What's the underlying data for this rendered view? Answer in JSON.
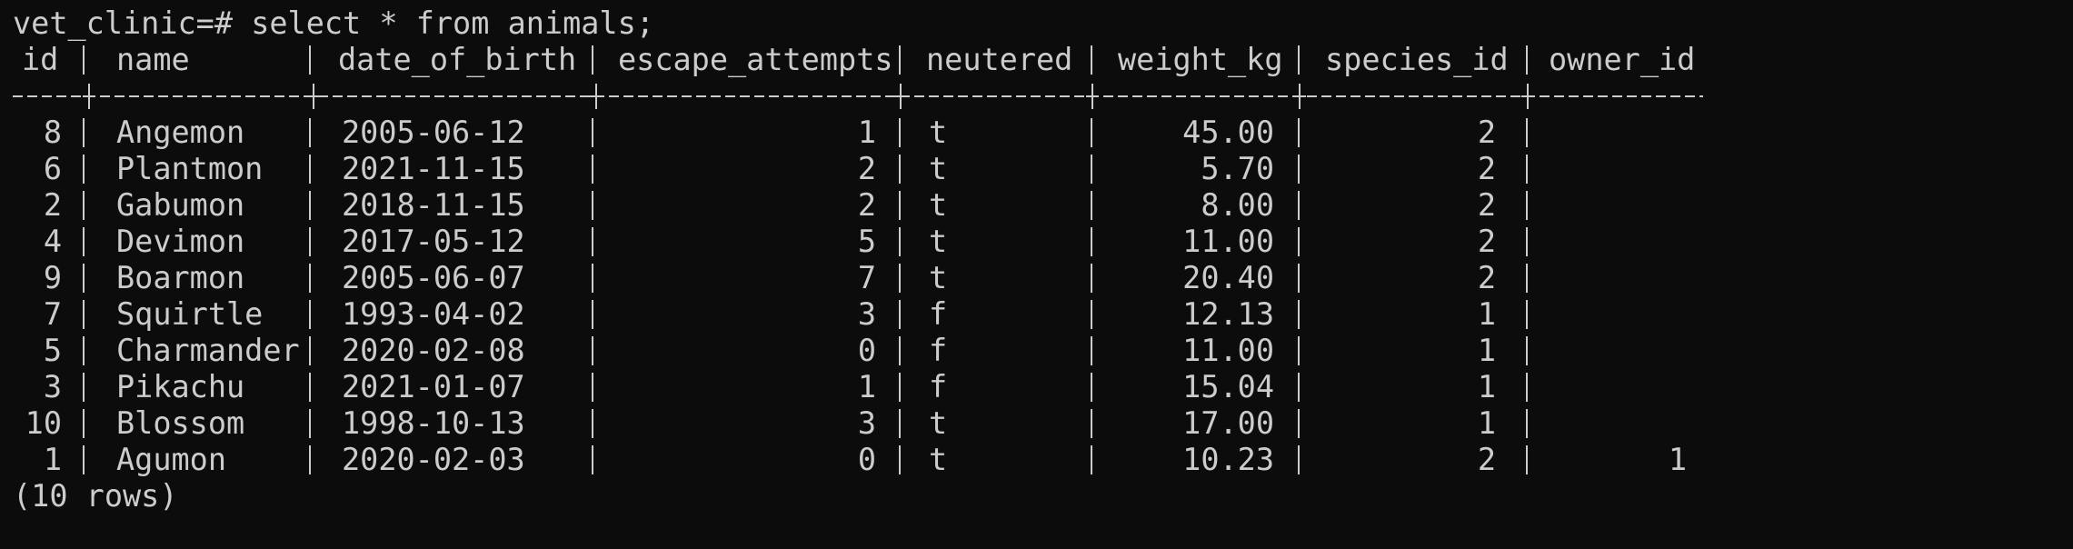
{
  "terminal": {
    "prompt": "vet_clinic=# ",
    "command": "select * from animals;",
    "columns": [
      "id",
      "name",
      "date_of_birth",
      "escape_attempts",
      "neutered",
      "weight_kg",
      "species_id",
      "owner_id"
    ],
    "rows": [
      [
        "8",
        "Angemon",
        "2005-06-12",
        "1",
        "t",
        "45.00",
        "2",
        ""
      ],
      [
        "6",
        "Plantmon",
        "2021-11-15",
        "2",
        "t",
        "5.70",
        "2",
        ""
      ],
      [
        "2",
        "Gabumon",
        "2018-11-15",
        "2",
        "t",
        "8.00",
        "2",
        ""
      ],
      [
        "4",
        "Devimon",
        "2017-05-12",
        "5",
        "t",
        "11.00",
        "2",
        ""
      ],
      [
        "9",
        "Boarmon",
        "2005-06-07",
        "7",
        "t",
        "20.40",
        "2",
        ""
      ],
      [
        "7",
        "Squirtle",
        "1993-04-02",
        "3",
        "f",
        "12.13",
        "1",
        ""
      ],
      [
        "5",
        "Charmander",
        "2020-02-08",
        "0",
        "f",
        "11.00",
        "1",
        ""
      ],
      [
        "3",
        "Pikachu",
        "2021-01-07",
        "1",
        "f",
        "15.04",
        "1",
        ""
      ],
      [
        "10",
        "Blossom",
        "1998-10-13",
        "3",
        "t",
        "17.00",
        "1",
        ""
      ],
      [
        "1",
        "Agumon",
        "2020-02-03",
        "0",
        "t",
        "10.23",
        "2",
        "1"
      ]
    ],
    "footer": "(10 rows)"
  }
}
